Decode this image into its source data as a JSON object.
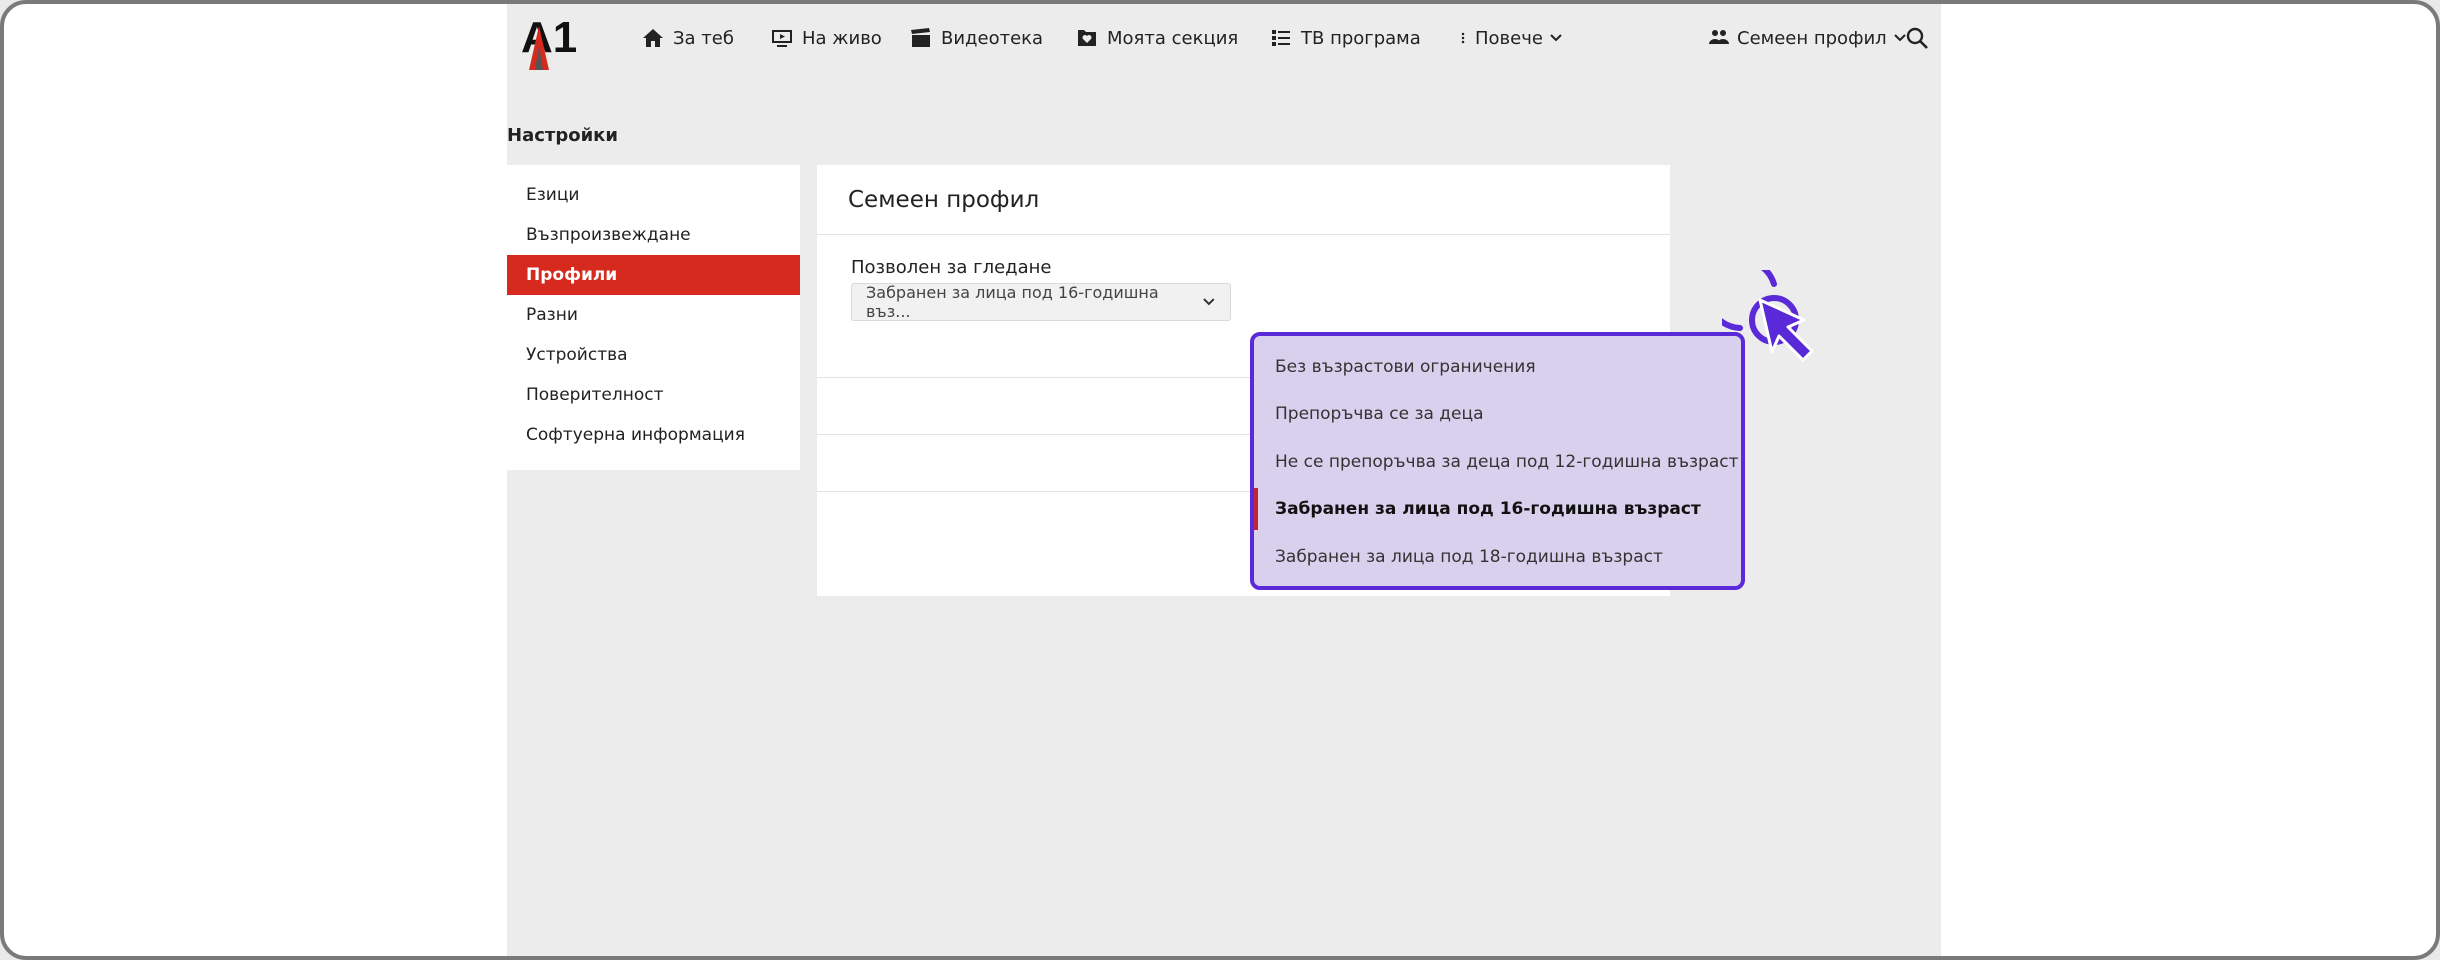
{
  "nav": {
    "logo_text": "A1",
    "items": [
      {
        "label": "За теб",
        "icon": "home-icon"
      },
      {
        "label": "На живо",
        "icon": "tv-play-icon"
      },
      {
        "label": "Видеотека",
        "icon": "clapperboard-icon"
      },
      {
        "label": "Моята секция",
        "icon": "heart-folder-icon"
      },
      {
        "label": "ТВ програма",
        "icon": "list-icon"
      },
      {
        "label": "Повече",
        "icon": "more-vertical-icon"
      }
    ],
    "profile_label": "Семеен профил",
    "profile_icon": "users-icon",
    "search_icon": "search-icon"
  },
  "settings": {
    "title": "Настройки",
    "sidebar": [
      {
        "label": "Езици"
      },
      {
        "label": "Възпроизвеждане"
      },
      {
        "label": "Профили",
        "active": true
      },
      {
        "label": "Разни"
      },
      {
        "label": "Устройства"
      },
      {
        "label": "Поверителност"
      },
      {
        "label": "Софтуерна информация"
      }
    ]
  },
  "panel": {
    "title": "Семеен профил",
    "field_label": "Позволен за гледане",
    "select_value": "Забранен за лица под 16-годишна въз...",
    "toggles": [
      true,
      true
    ]
  },
  "dropdown": {
    "options": [
      {
        "label": "Без възрастови ограничения"
      },
      {
        "label": "Препоръчва се за деца"
      },
      {
        "label": "Не се препоръчва за деца под 12-годишна възраст"
      },
      {
        "label": "Забранен за лица под 16-годишна възраст",
        "selected": true
      },
      {
        "label": "Забранен за лица под 18-годишна възраст"
      }
    ]
  },
  "colors": {
    "accent_red": "#d62a1e",
    "highlight_purple": "#5a2ad8",
    "dropdown_bg": "#d9d0ee"
  }
}
